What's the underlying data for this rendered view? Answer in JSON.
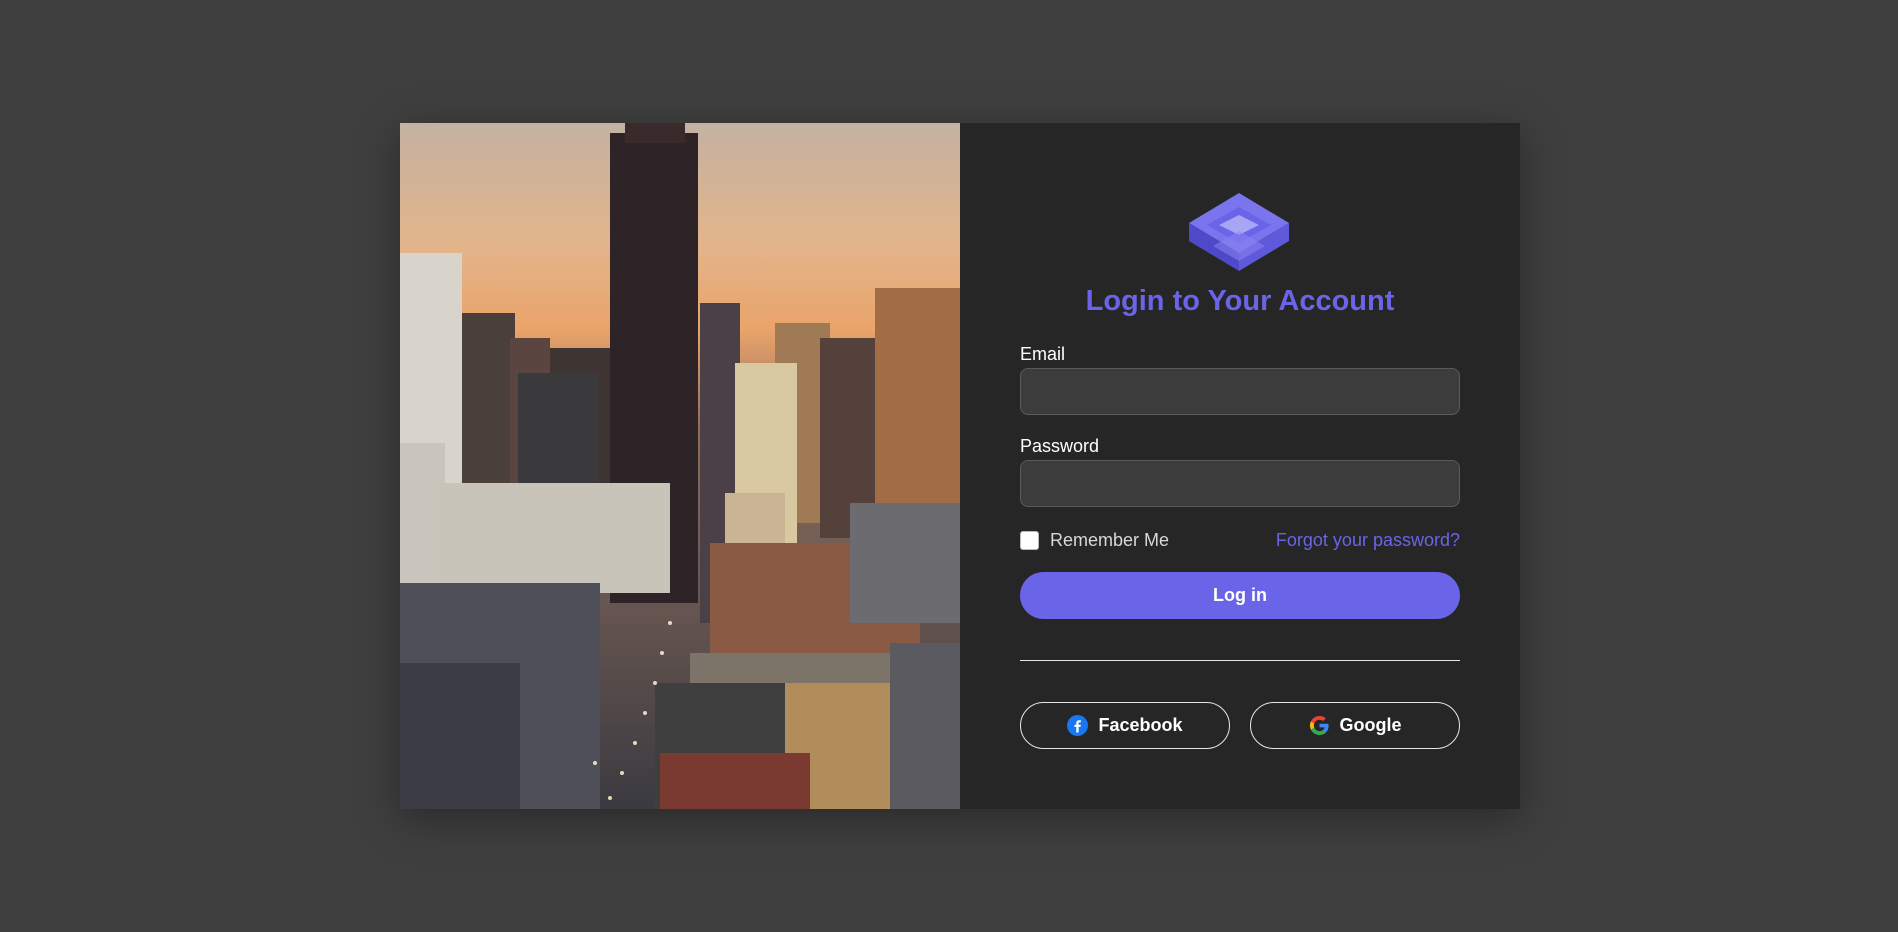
{
  "login": {
    "title": "Login to Your Account",
    "email_label": "Email",
    "email_value": "",
    "password_label": "Password",
    "password_value": "",
    "remember_label": "Remember Me",
    "forgot_label": "Forgot your password?",
    "login_label": "Log in",
    "facebook_label": "Facebook",
    "google_label": "Google"
  },
  "colors": {
    "accent": "#6a64e8",
    "panel": "#262626",
    "background": "#3f3f3f"
  },
  "icons": {
    "logo": "layers-logo-icon",
    "facebook": "facebook-icon",
    "google": "google-icon"
  }
}
